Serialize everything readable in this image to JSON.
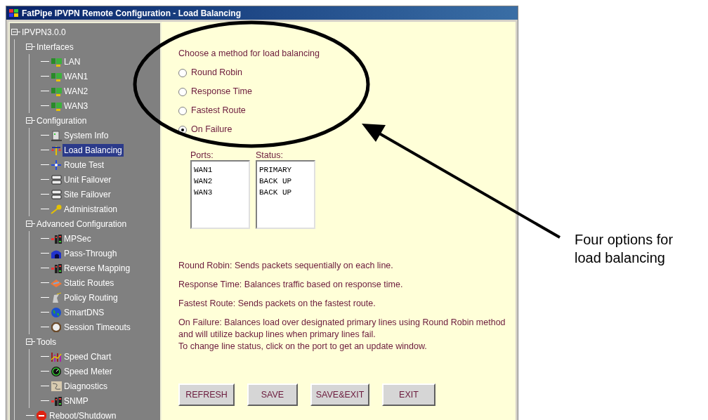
{
  "window": {
    "title": "FatPipe IPVPN Remote Configuration - Load Balancing"
  },
  "tree": [
    {
      "label": "IPVPN3.0.0",
      "selected": false,
      "expanded": true,
      "children": [
        {
          "label": "Interfaces",
          "selected": false,
          "expanded": true,
          "children": [
            {
              "label": "LAN",
              "selected": false
            },
            {
              "label": "WAN1",
              "selected": false
            },
            {
              "label": "WAN2",
              "selected": false
            },
            {
              "label": "WAN3",
              "selected": false
            }
          ]
        },
        {
          "label": "Configuration",
          "selected": false,
          "expanded": true,
          "children": [
            {
              "label": "System Info",
              "selected": false
            },
            {
              "label": "Load Balancing",
              "selected": true
            },
            {
              "label": "Route Test",
              "selected": false
            },
            {
              "label": "Unit Failover",
              "selected": false
            },
            {
              "label": "Site Failover",
              "selected": false
            },
            {
              "label": "Administration",
              "selected": false
            }
          ]
        },
        {
          "label": "Advanced Configuration",
          "selected": false,
          "expanded": true,
          "children": [
            {
              "label": "MPSec",
              "selected": false
            },
            {
              "label": "Pass-Through",
              "selected": false
            },
            {
              "label": "Reverse Mapping",
              "selected": false
            },
            {
              "label": "Static Routes",
              "selected": false
            },
            {
              "label": "Policy Routing",
              "selected": false
            },
            {
              "label": "SmartDNS",
              "selected": false
            },
            {
              "label": "Session Timeouts",
              "selected": false
            }
          ]
        },
        {
          "label": "Tools",
          "selected": false,
          "expanded": true,
          "children": [
            {
              "label": "Speed Chart",
              "selected": false
            },
            {
              "label": "Speed Meter",
              "selected": false
            },
            {
              "label": "Diagnostics",
              "selected": false
            },
            {
              "label": "SNMP",
              "selected": false
            }
          ]
        },
        {
          "label": "Reboot/Shutdown",
          "selected": false
        }
      ]
    }
  ],
  "prompt": "Choose a method for load balancing",
  "methods": [
    {
      "label": "Round Robin",
      "selected": false
    },
    {
      "label": "Response Time",
      "selected": false
    },
    {
      "label": "Fastest Route",
      "selected": false
    },
    {
      "label": "On Failure",
      "selected": true
    }
  ],
  "ports_label": "Ports:",
  "status_label": "Status:",
  "ports": [
    {
      "port": "WAN1",
      "status": "PRIMARY"
    },
    {
      "port": "WAN2",
      "status": "BACK UP"
    },
    {
      "port": "WAN3",
      "status": "BACK UP"
    }
  ],
  "descriptions": [
    "Round Robin:  Sends packets sequentially on each line.",
    "Response Time:  Balances traffic based on response time.",
    "Fastest Route:  Sends packets on the fastest route.",
    "On Failure:  Balances load over designated primary lines using Round Robin method and will utilize backup lines when primary lines fail.",
    "To change line status, click on the port to get an update window."
  ],
  "buttons": [
    "REFRESH",
    "SAVE",
    "SAVE&EXIT",
    "EXIT"
  ],
  "callout": "Four options for load balancing"
}
